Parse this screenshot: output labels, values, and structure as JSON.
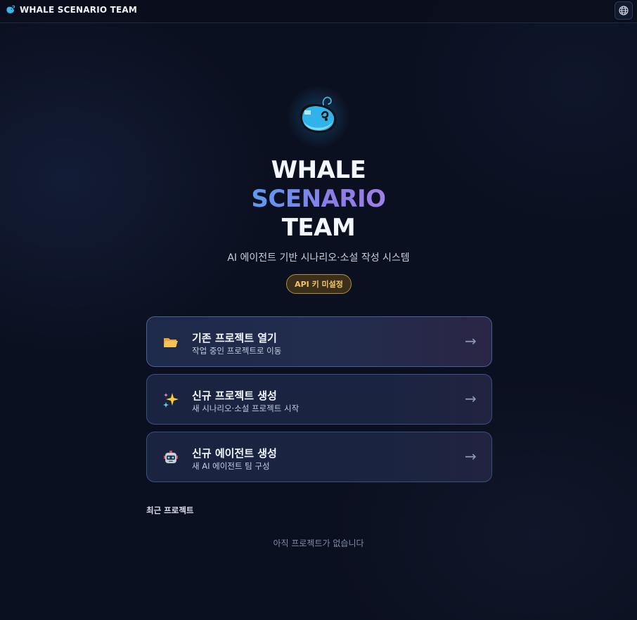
{
  "header": {
    "brand_text": "WHALE SCENARIO TEAM",
    "brand_icon": "whale-icon",
    "language_icon": "globe-icon"
  },
  "hero": {
    "logo_icon": "whale-icon",
    "title_line1": "WHALE",
    "title_line2": "SCENARIO",
    "title_line3": "TEAM",
    "subtitle": "AI 에이전트 기반 시나리오·소설 작성 시스템",
    "api_badge": "API 키 미설정"
  },
  "actions": [
    {
      "icon": "folder-icon",
      "title": "기존 프로젝트 열기",
      "subtitle": "작업 중인 프로젝트로 이동",
      "arrow": "→"
    },
    {
      "icon": "sparkles-icon",
      "title": "신규 프로젝트 생성",
      "subtitle": "새 시나리오·소설 프로젝트 시작",
      "arrow": "→"
    },
    {
      "icon": "robot-icon",
      "title": "신규 에이전트 생성",
      "subtitle": "새 AI 에이전트 팀 구성",
      "arrow": "→"
    }
  ],
  "recent": {
    "label": "최근 프로젝트",
    "empty_text": "아직 프로젝트가 없습니다"
  },
  "colors": {
    "background": "#0b1020",
    "accent_blue": "#5b9cf0",
    "accent_purple": "#a07fe8",
    "badge_text": "#f5c46a"
  }
}
